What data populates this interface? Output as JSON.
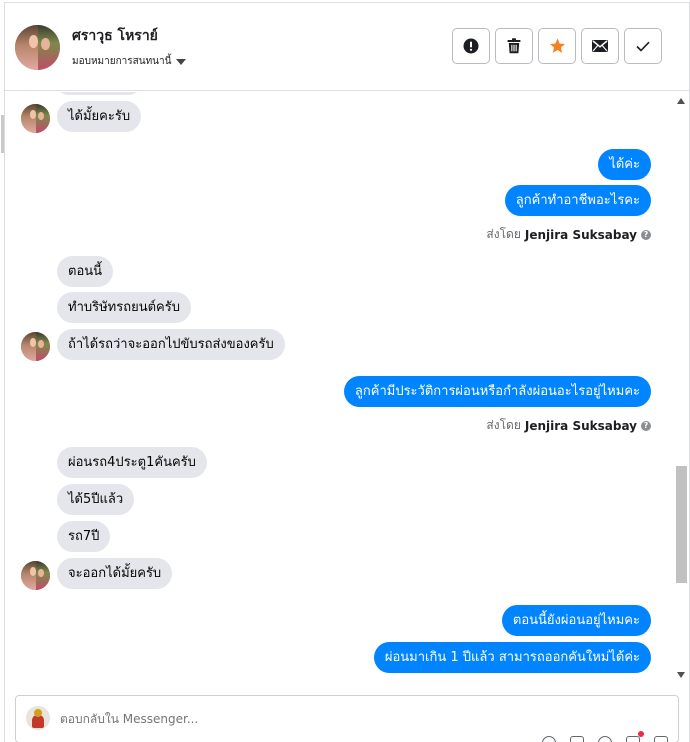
{
  "header": {
    "contact_name": "ศราวุธ โหราย์",
    "assign_label": "มอบหมายการสนทนานี้"
  },
  "actions": {
    "report_icon": "exclamation-icon",
    "delete_icon": "trash-icon",
    "star_icon": "star-icon",
    "unread_icon": "envelope-icon",
    "done_icon": "check-icon",
    "star_color": "#f5821f"
  },
  "messages": [
    {
      "side": "in",
      "text": "ได้มั้ยคะรับ"
    },
    {
      "side": "out",
      "text": "ได้ค่ะ"
    },
    {
      "side": "out",
      "text": "ลูกค้าทำอาชีพอะไรคะ"
    },
    {
      "side": "in",
      "text": "ตอนนี้"
    },
    {
      "side": "in",
      "text": "ทำบริษัทรถยนต์ครับ"
    },
    {
      "side": "in",
      "text": "ถ้าได้รถว่าจะออกไปขับรถส่งของครับ"
    },
    {
      "side": "out",
      "text": "ลูกค้ามีประวัติการผ่อนหรือกำลังผ่อนอะไรอยู่ไหมคะ"
    },
    {
      "side": "in",
      "text": "ผ่อนรถ4ประตู1คันครับ"
    },
    {
      "side": "in",
      "text": "ได้5ปีแล้ว"
    },
    {
      "side": "in",
      "text": "รถ7ปี"
    },
    {
      "side": "in",
      "text": "จะออกได้มั้ยครับ"
    },
    {
      "side": "out",
      "text": "ตอนนี้ยังผ่อนอยู่ไหมคะ"
    },
    {
      "side": "out",
      "text": "ผ่อนมาเกิน 1 ปีแล้ว สามารถออกคันใหม่ได้ค่ะ"
    }
  ],
  "sent_by": {
    "prefix": "ส่งโดย",
    "agent": "Jenjira Suksabay",
    "help_glyph": "?"
  },
  "composer": {
    "placeholder": "ตอบกลับใน Messenger..."
  },
  "colors": {
    "outgoing_bubble": "#0084ff",
    "incoming_bubble": "#e4e6eb"
  }
}
